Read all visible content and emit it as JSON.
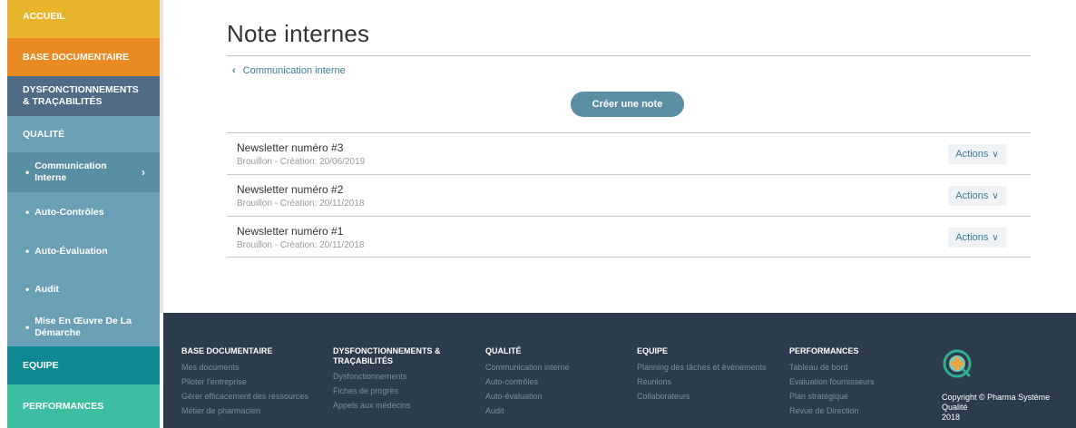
{
  "sidebar": {
    "accueil": "ACCUEIL",
    "base": "BASE DOCUMENTAIRE",
    "dysf_line1": "DYSFONCTIONNEMENTS",
    "dysf_line2": "& TRAÇABILITÉS",
    "qualite": "QUALITÉ",
    "sub_items": {
      "comm_line1": "Communication",
      "comm_line2": "Interne",
      "auto_controles": "Auto-Contrôles",
      "auto_evaluation": "Auto-Évaluation",
      "audit": "Audit",
      "mise_line1": "Mise En Œuvre De La",
      "mise_line2": "Démarche"
    },
    "equipe": "EQUIPE",
    "performances": "PERFORMANCES",
    "colors": {
      "accueil": "#e9b52c",
      "base": "#ea8a22",
      "dysf": "#4f6b85",
      "qualite": "#6a9fb5",
      "equipe": "#0e8892",
      "performances": "#3cbfa0"
    }
  },
  "main": {
    "title": "Note internes",
    "breadcrumb": "Communication interne",
    "create_button": "Créer une note",
    "notes": [
      {
        "title": "Newsletter numéro #3",
        "status": "Brouillon - Création: 20/06/2019",
        "actions": "Actions"
      },
      {
        "title": "Newsletter numéro #2",
        "status": "Brouillon - Création: 20/11/2018",
        "actions": "Actions"
      },
      {
        "title": "Newsletter numéro #1",
        "status": "Brouillon - Création: 20/11/2018",
        "actions": "Actions"
      }
    ]
  },
  "footer": {
    "columns": [
      {
        "heading": "BASE DOCUMENTAIRE",
        "links": [
          "Mes documents",
          "Piloter l'entreprise",
          "Gérer efficacement des ressources",
          "Métier de pharmacien"
        ]
      },
      {
        "heading_line1": "DYSFONCTIONNEMENTS &",
        "heading_line2": "TRAÇABILITÉS",
        "links": [
          "Dysfonctionnements",
          "Fiches de progrès",
          "Appels aux médecins"
        ]
      },
      {
        "heading": "QUALITÉ",
        "links": [
          "Communication interne",
          "Auto-contrôles",
          "Auto-évaluation",
          "Audit"
        ]
      },
      {
        "heading": "EQUIPE",
        "links": [
          "Planning des tâches et évènements",
          "Réunions",
          "Collaborateurs"
        ]
      },
      {
        "heading": "PERFORMANCES",
        "links": [
          "Tableau de bord",
          "Evaluation fournisseurs",
          "Plan stratégique",
          "Revue de Direction"
        ]
      }
    ],
    "copyright_line1": "Copyright © Pharma Système Qualité",
    "copyright_line2": "2018"
  }
}
